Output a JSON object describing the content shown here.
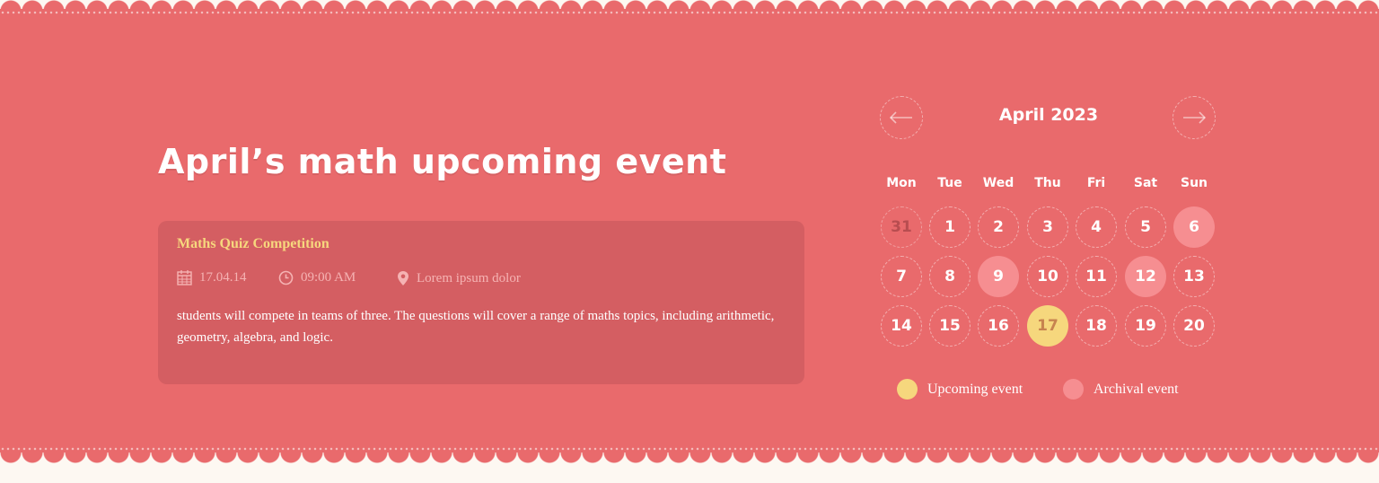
{
  "section": {
    "title": "April’s math upcoming event"
  },
  "event": {
    "title": "Maths Quiz Competition",
    "date": "17.04.14",
    "time": "09:00 AM",
    "location": "Lorem ipsum dolor",
    "description": "students will compete in teams of three. The questions will cover a range of maths topics, including arithmetic, geometry, algebra, and logic."
  },
  "calendar": {
    "month_label": "April 2023",
    "prev_icon": "arrow-left-icon",
    "next_icon": "arrow-right-icon",
    "weekdays": [
      "Mon",
      "Tue",
      "Wed",
      "Thu",
      "Fri",
      "Sat",
      "Sun"
    ],
    "days": [
      "31",
      "1",
      "2",
      "3",
      "4",
      "5",
      "6",
      "7",
      "8",
      "9",
      "10",
      "11",
      "12",
      "13",
      "14",
      "15",
      "16",
      "17",
      "18",
      "19",
      "20"
    ],
    "muted_days": [
      "31"
    ],
    "archival_days": [
      "6",
      "9",
      "12"
    ],
    "upcoming_days": [
      "17"
    ]
  },
  "legend": {
    "upcoming": "Upcoming event",
    "archival": "Archival event"
  },
  "colors": {
    "background": "#e96a6c",
    "card": "#d45e62",
    "upcoming": "#f6d77d",
    "archival": "#f68e91"
  }
}
